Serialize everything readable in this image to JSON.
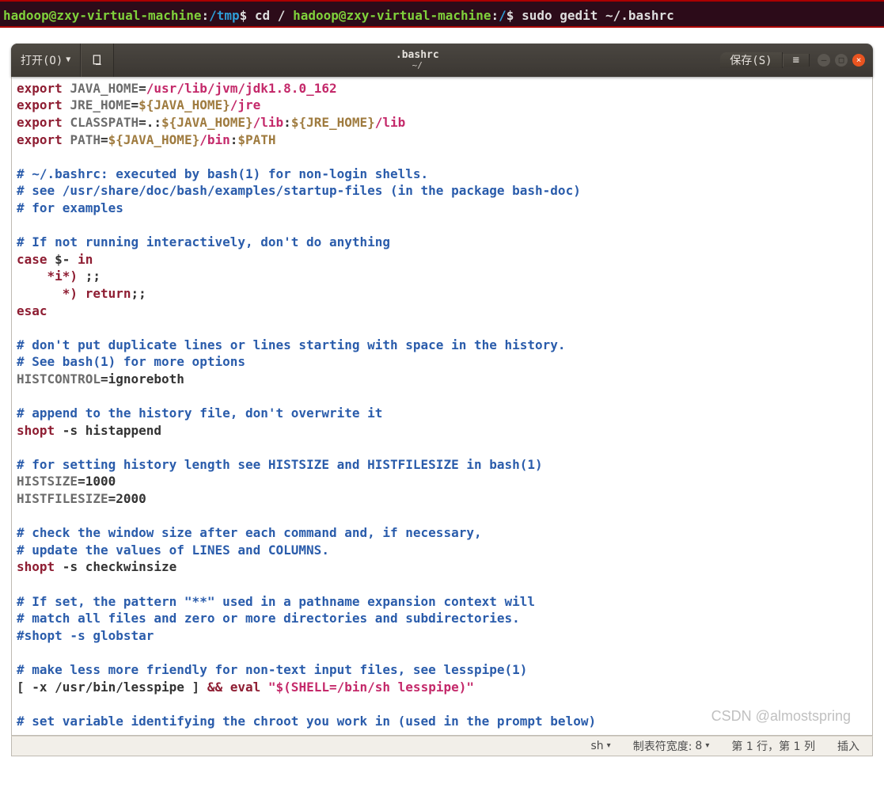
{
  "terminal": {
    "lines": [
      {
        "user": "hadoop",
        "host": "zxy-virtual-machine",
        "path": "/tmp",
        "cmd": "cd /"
      },
      {
        "user": "hadoop",
        "host": "zxy-virtual-machine",
        "path": "/",
        "cmd": "sudo gedit ~/.bashrc"
      }
    ]
  },
  "header": {
    "open_label": "打开(O)",
    "save_label": "保存(S)",
    "file_title": ".bashrc",
    "file_subtitle": "~/"
  },
  "editor": {
    "tokens": [
      [
        [
          "kw-export",
          "export"
        ],
        [
          "plain",
          " "
        ],
        [
          "var-name",
          "JAVA_HOME"
        ],
        [
          "plain",
          "="
        ],
        [
          "str-path",
          "/usr/lib/jvm/jdk1.8.0_162"
        ]
      ],
      [
        [
          "kw-export",
          "export"
        ],
        [
          "plain",
          " "
        ],
        [
          "var-name",
          "JRE_HOME"
        ],
        [
          "plain",
          "="
        ],
        [
          "sh-var",
          "${JAVA_HOME}"
        ],
        [
          "str-path",
          "/jre"
        ]
      ],
      [
        [
          "kw-export",
          "export"
        ],
        [
          "plain",
          " "
        ],
        [
          "var-name",
          "CLASSPATH"
        ],
        [
          "plain",
          "=.:"
        ],
        [
          "sh-var",
          "${JAVA_HOME}"
        ],
        [
          "str-path",
          "/lib"
        ],
        [
          "plain",
          ":"
        ],
        [
          "sh-var",
          "${JRE_HOME}"
        ],
        [
          "str-path",
          "/lib"
        ]
      ],
      [
        [
          "kw-export",
          "export"
        ],
        [
          "plain",
          " "
        ],
        [
          "var-name",
          "PATH"
        ],
        [
          "plain",
          "="
        ],
        [
          "sh-var",
          "${JAVA_HOME}"
        ],
        [
          "str-path",
          "/bin"
        ],
        [
          "plain",
          ":"
        ],
        [
          "sh-var",
          "$PATH"
        ]
      ],
      [
        [
          "plain",
          ""
        ]
      ],
      [
        [
          "comment",
          "# ~/.bashrc: executed by bash(1) for non-login shells."
        ]
      ],
      [
        [
          "comment",
          "# see /usr/share/doc/bash/examples/startup-files (in the package bash-doc)"
        ]
      ],
      [
        [
          "comment",
          "# for examples"
        ]
      ],
      [
        [
          "plain",
          ""
        ]
      ],
      [
        [
          "comment",
          "# If not running interactively, don't do anything"
        ]
      ],
      [
        [
          "kw-shell",
          "case"
        ],
        [
          "plain",
          " $- "
        ],
        [
          "kw-shell",
          "in"
        ]
      ],
      [
        [
          "plain",
          "    "
        ],
        [
          "kw-shell",
          "*i*)"
        ],
        [
          "plain",
          " ;;"
        ]
      ],
      [
        [
          "plain",
          "      "
        ],
        [
          "kw-shell",
          "*)"
        ],
        [
          "plain",
          " "
        ],
        [
          "kw-shell",
          "return"
        ],
        [
          "plain",
          ";;"
        ]
      ],
      [
        [
          "kw-shell",
          "esac"
        ]
      ],
      [
        [
          "plain",
          ""
        ]
      ],
      [
        [
          "comment",
          "# don't put duplicate lines or lines starting with space in the history."
        ]
      ],
      [
        [
          "comment",
          "# See bash(1) for more options"
        ]
      ],
      [
        [
          "var-name",
          "HISTCONTROL"
        ],
        [
          "plain",
          "=ignoreboth"
        ]
      ],
      [
        [
          "plain",
          ""
        ]
      ],
      [
        [
          "comment",
          "# append to the history file, don't overwrite it"
        ]
      ],
      [
        [
          "kw-shell",
          "shopt"
        ],
        [
          "plain",
          " -s histappend"
        ]
      ],
      [
        [
          "plain",
          ""
        ]
      ],
      [
        [
          "comment",
          "# for setting history length see HISTSIZE and HISTFILESIZE in bash(1)"
        ]
      ],
      [
        [
          "var-name",
          "HISTSIZE"
        ],
        [
          "plain",
          "=1000"
        ]
      ],
      [
        [
          "var-name",
          "HISTFILESIZE"
        ],
        [
          "plain",
          "=2000"
        ]
      ],
      [
        [
          "plain",
          ""
        ]
      ],
      [
        [
          "comment",
          "# check the window size after each command and, if necessary,"
        ]
      ],
      [
        [
          "comment",
          "# update the values of LINES and COLUMNS."
        ]
      ],
      [
        [
          "kw-shell",
          "shopt"
        ],
        [
          "plain",
          " -s checkwinsize"
        ]
      ],
      [
        [
          "plain",
          ""
        ]
      ],
      [
        [
          "comment",
          "# If set, the pattern \"**\" used in a pathname expansion context will"
        ]
      ],
      [
        [
          "comment",
          "# match all files and zero or more directories and subdirectories."
        ]
      ],
      [
        [
          "comment",
          "#shopt -s globstar"
        ]
      ],
      [
        [
          "plain",
          ""
        ]
      ],
      [
        [
          "comment",
          "# make less more friendly for non-text input files, see lesspipe(1)"
        ]
      ],
      [
        [
          "plain",
          "[ -x /usr/bin/lesspipe ] "
        ],
        [
          "bool-op",
          "&&"
        ],
        [
          "plain",
          " "
        ],
        [
          "kw-shell",
          "eval"
        ],
        [
          "plain",
          " "
        ],
        [
          "str-path",
          "\"$(SHELL=/bin/sh lesspipe)\""
        ]
      ],
      [
        [
          "plain",
          ""
        ]
      ],
      [
        [
          "comment",
          "# set variable identifying the chroot you work in (used in the prompt below)"
        ]
      ]
    ]
  },
  "statusbar": {
    "lang": "sh",
    "tab_label": "制表符宽度:",
    "tab_value": "8",
    "position": "第 1 行，第 1 列",
    "mode": "插入"
  },
  "watermark": "CSDN @almostspring"
}
